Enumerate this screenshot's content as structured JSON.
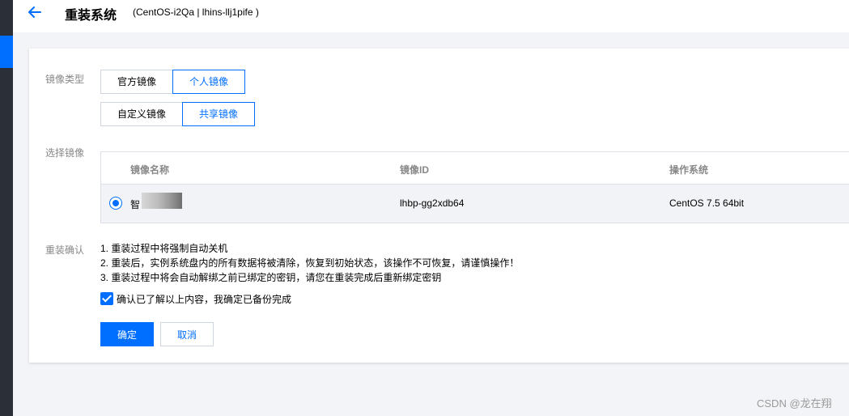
{
  "header": {
    "title": "重装系统",
    "subtitle": "(CentOS-i2Qa | lhins-llj1pife )"
  },
  "form": {
    "image_type_label": "镜像类型",
    "image_type_tabs": [
      {
        "label": "官方镜像",
        "active": false
      },
      {
        "label": "个人镜像",
        "active": true
      }
    ],
    "image_subtype_tabs": [
      {
        "label": "自定义镜像",
        "active": false
      },
      {
        "label": "共享镜像",
        "active": true
      }
    ],
    "select_image_label": "选择镜像",
    "table": {
      "columns": [
        "镜像名称",
        "镜像ID",
        "操作系统"
      ],
      "rows": [
        {
          "name": "智",
          "id": "lhbp-gg2xdb64",
          "os": "CentOS 7.5 64bit",
          "selected": true
        }
      ]
    },
    "confirm_label": "重装确认",
    "notes": [
      "1. 重装过程中将强制自动关机",
      "2. 重装后，实例系统盘内的所有数据将被清除，恢复到初始状态，该操作不可恢复，请谨慎操作！",
      "3. 重装过程中将会自动解绑之前已绑定的密钥，请您在重装完成后重新绑定密钥"
    ],
    "acknowledge": {
      "label": "确认已了解以上内容，我确定已备份完成",
      "checked": true
    },
    "ok_label": "确定",
    "cancel_label": "取消"
  },
  "watermark": "CSDN @龙在翔",
  "colors": {
    "accent": "#006eff",
    "sidebar": "#2b2f37",
    "row_selected": "#f1f3f6"
  },
  "icons": {
    "back": "arrow-left-icon",
    "check": "check-icon"
  }
}
